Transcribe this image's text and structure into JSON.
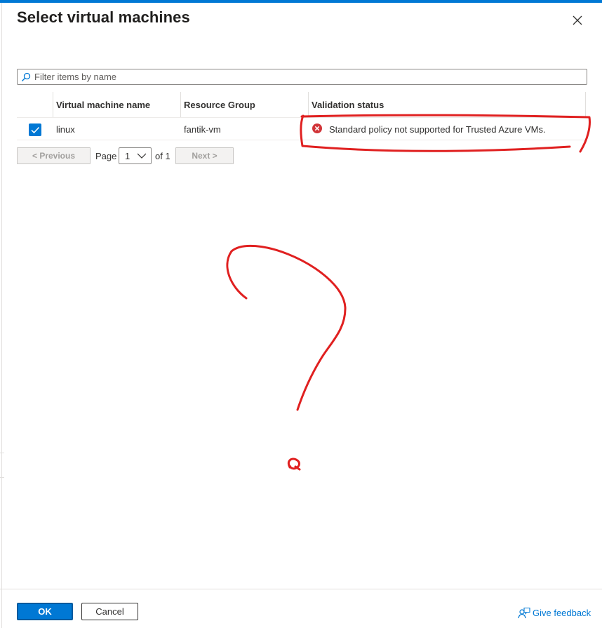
{
  "dialog": {
    "title": "Select virtual machines",
    "close_icon": "close-icon"
  },
  "filter": {
    "placeholder": "Filter items by name",
    "value": "",
    "icon": "search-icon"
  },
  "table": {
    "columns": [
      "Virtual machine name",
      "Resource Group",
      "Validation status"
    ],
    "rows": [
      {
        "selected": true,
        "vm_name": "linux",
        "resource_group": "fantik-vm",
        "validation_status": "Standard policy not supported for Trusted Azure VMs.",
        "status_icon": "error-icon"
      }
    ]
  },
  "pager": {
    "previous_label": "< Previous",
    "page_label": "Page",
    "current_page": "1",
    "of_label": "of 1",
    "next_label": "Next >",
    "previous_enabled": false,
    "next_enabled": false
  },
  "footer": {
    "ok_label": "OK",
    "cancel_label": "Cancel",
    "feedback_label": "Give feedback",
    "feedback_icon": "feedback-icon"
  },
  "colors": {
    "accent": "#0078d4",
    "error": "#d13438",
    "annotation": "#e02020"
  }
}
